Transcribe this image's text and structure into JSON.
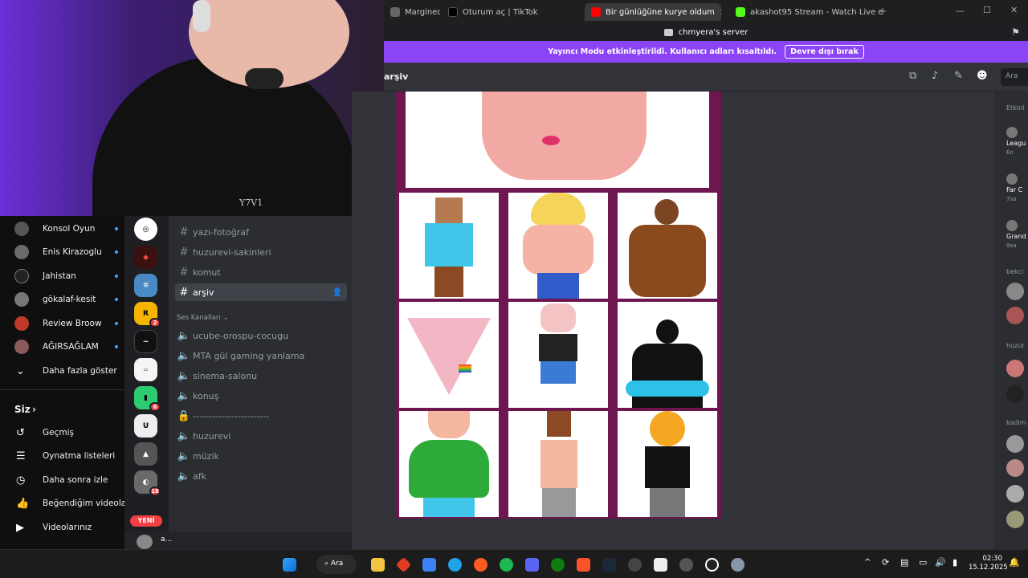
{
  "browser": {
    "tabs": [
      {
        "label": "Margined F",
        "active": false
      },
      {
        "label": "Oturum aç | TikTok",
        "active": false
      },
      {
        "label": "Bir günlüğüne kurye oldum",
        "active": true
      },
      {
        "label": "akashot95 Stream - Watch Live on Ki",
        "active": false
      }
    ]
  },
  "discord": {
    "server_title": "chmyera's server",
    "banner_text": "Yayıncı Modu etkinleştirildi. Kullanıcı adları kısaltıldı.",
    "banner_button": "Devre dışı bırak",
    "channel_name": "arşiv",
    "search_placeholder": "Ara",
    "text_channels": [
      "yazı-fotoğraf",
      "huzurevi-sakinleri",
      "komut",
      "arşiv"
    ],
    "voice_category": "Ses Kanalları",
    "voice_channels": [
      "ucube-orospu-cocugu",
      "MTA gül gaming yanlama",
      "sinema-salonu",
      "konuş",
      "------------------------",
      "huzurevi",
      "müzik",
      "afk"
    ],
    "guild_badges": [
      "2",
      "6",
      "18"
    ],
    "new_label": "YENİ",
    "user_short": "a...",
    "members": {
      "header": "Etkinl",
      "items": [
        "Leagu",
        "En",
        "Far C",
        "7sa",
        "Grand",
        "9sa"
      ],
      "group_a": "bekci",
      "group_b": "huzur",
      "group_c": "kadim"
    }
  },
  "youtube": {
    "subscriptions": [
      "Konsol Oyun",
      "Enis Kirazoglu",
      "Jahistan",
      "gökalaf-kesit",
      "Review Broow",
      "AĞIRSAĞLAM"
    ],
    "show_more": "Daha fazla göster",
    "you_section": "Siz",
    "you_items": [
      "Geçmiş",
      "Oynatma listeleri",
      "Daha sonra izle",
      "Beğendiğim videolar",
      "Videolarınız"
    ],
    "colors": {
      "accent": "#3ea6ff"
    }
  },
  "webcam": {
    "shirt_text": "Y7V1"
  },
  "taskbar": {
    "search": "Ara",
    "time": "02:30",
    "date": "15.12.2025"
  }
}
